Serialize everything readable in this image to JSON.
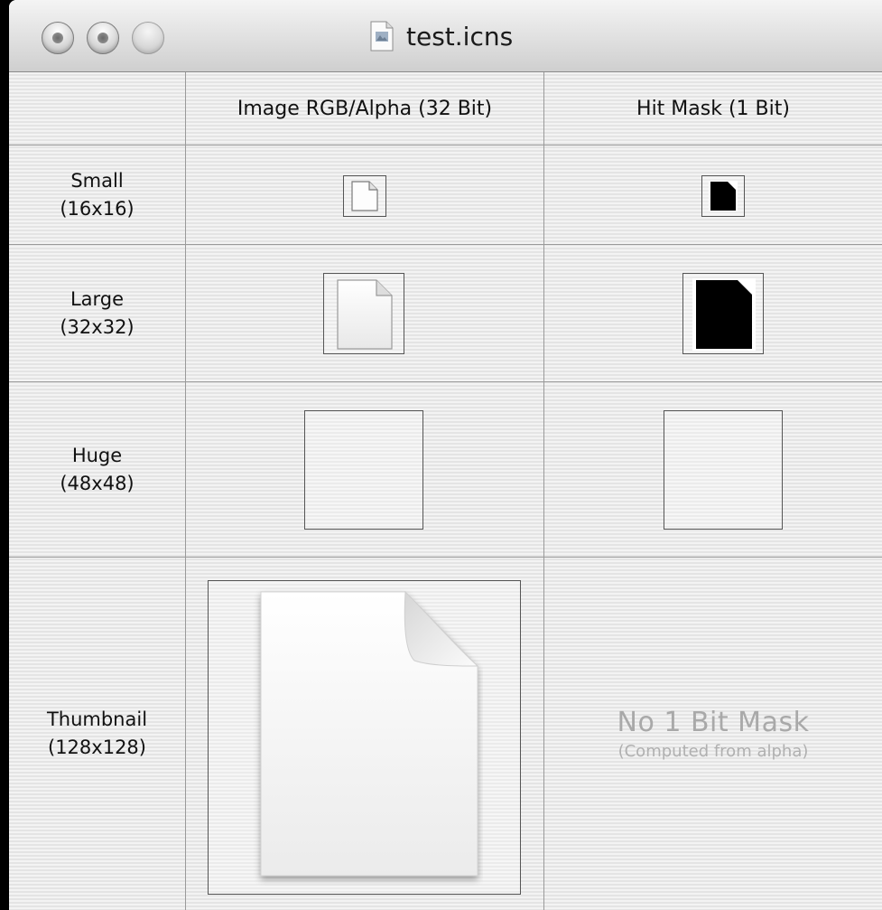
{
  "window": {
    "title": "test.icns",
    "title_icon": "document-icon"
  },
  "titlebar": {
    "buttons": [
      {
        "name": "close-button",
        "state": "inactive"
      },
      {
        "name": "minimize-button",
        "state": "inactive"
      },
      {
        "name": "zoom-button",
        "state": "disabled"
      }
    ]
  },
  "table": {
    "columns": [
      {
        "label": "Image RGB/Alpha (32 Bit)"
      },
      {
        "label": "Hit Mask (1 Bit)"
      }
    ],
    "rows": [
      {
        "name": "Small",
        "size": "(16x16)",
        "image": "file-icon",
        "mask": "mask-icon"
      },
      {
        "name": "Large",
        "size": "(32x32)",
        "image": "file-icon",
        "mask": "mask-icon"
      },
      {
        "name": "Huge",
        "size": "(48x48)",
        "image": "empty",
        "mask": "empty"
      },
      {
        "name": "Thumbnail",
        "size": "(128x128)",
        "image": "file-icon",
        "mask": "none"
      }
    ],
    "no_mask": {
      "title": "No 1 Bit Mask",
      "subtitle": "(Computed from alpha)"
    }
  }
}
